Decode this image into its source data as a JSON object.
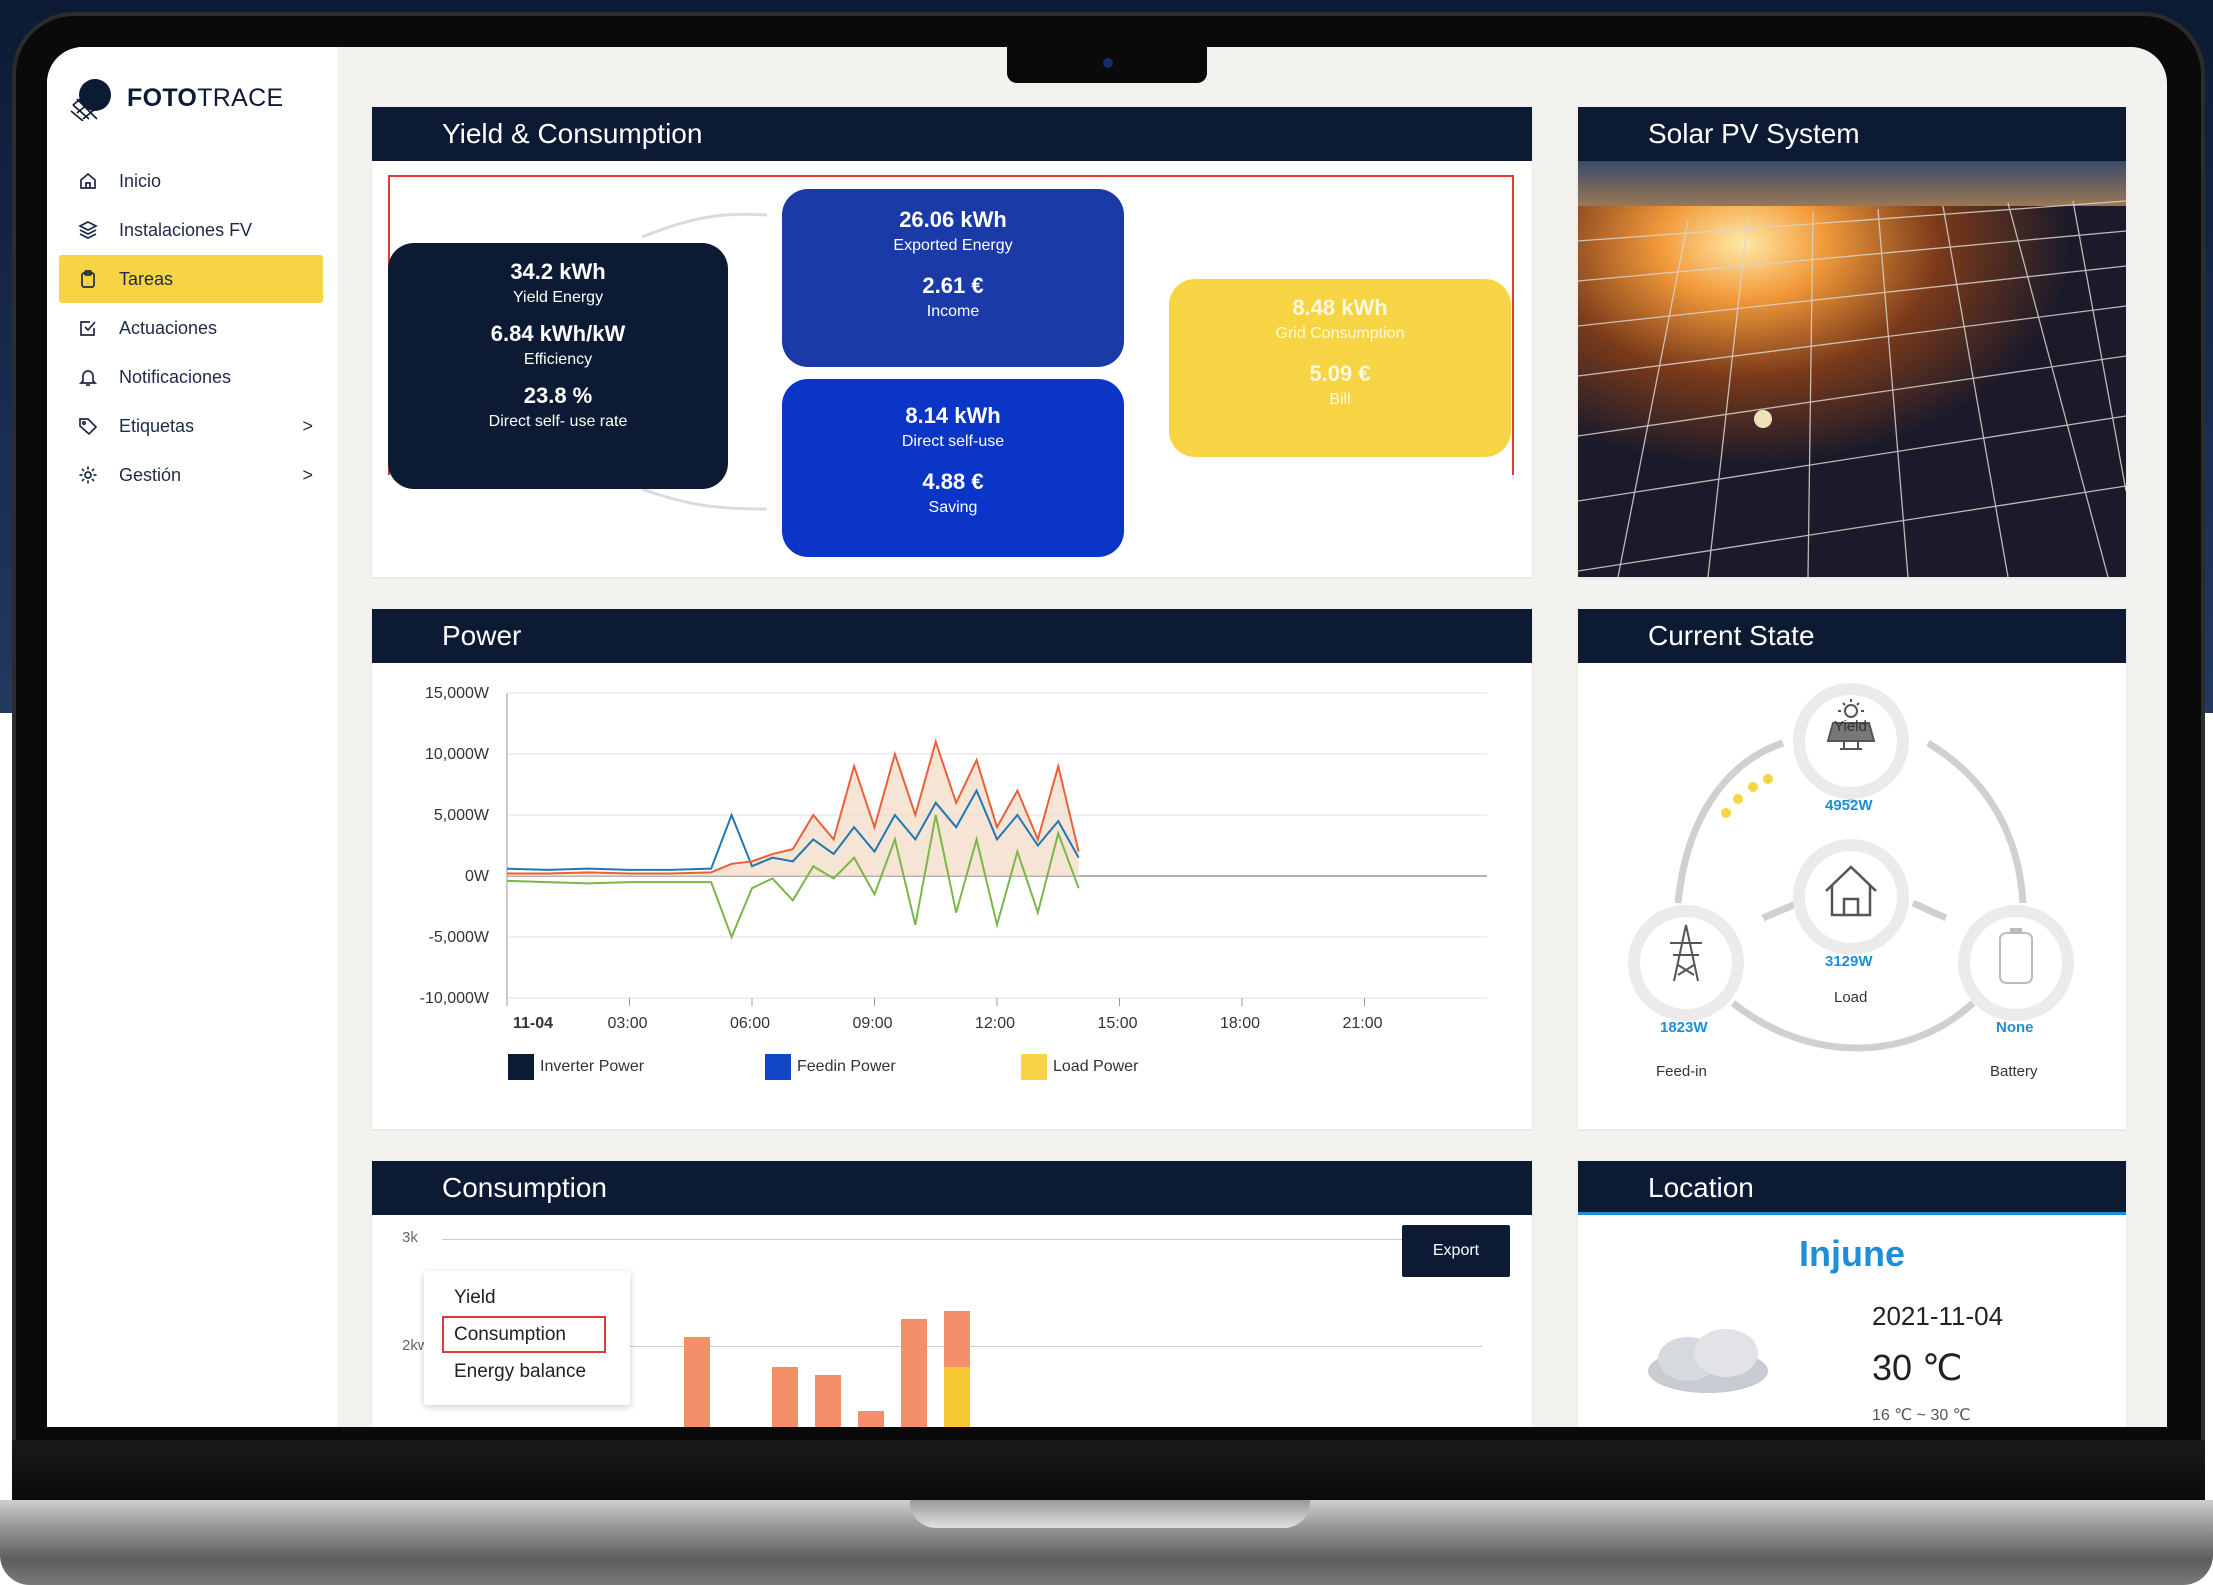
{
  "app": {
    "brand_bold": "FOTO",
    "brand_light": "TRACE"
  },
  "sidebar": {
    "items": [
      {
        "label": "Inicio",
        "icon": "home-icon"
      },
      {
        "label": "Instalaciones FV",
        "icon": "layers-icon"
      },
      {
        "label": "Tareas",
        "icon": "clipboard-icon",
        "active": true
      },
      {
        "label": "Actuaciones",
        "icon": "checkbox-icon"
      },
      {
        "label": "Notificaciones",
        "icon": "bell-icon"
      },
      {
        "label": "Etiquetas",
        "icon": "tag-icon",
        "chevron": ">"
      },
      {
        "label": "Gestión",
        "icon": "gear-icon",
        "chevron": ">"
      }
    ]
  },
  "yield_consumption": {
    "title": "Yield & Consumption",
    "yield_box": {
      "v1": "34.2 kWh",
      "l1": "Yield Energy",
      "v2": "6.84 kWh/kW",
      "l2": "Efficiency",
      "v3": "23.8 %",
      "l3": "Direct self- use rate"
    },
    "export_box": {
      "v1": "26.06 kWh",
      "l1": "Exported Energy",
      "v2": "2.61 €",
      "l2": "Income"
    },
    "selfuse_box": {
      "v1": "8.14 kWh",
      "l1": "Direct self-use",
      "v2": "4.88 €",
      "l2": "Saving"
    },
    "grid_box": {
      "v1": "8.48 kWh",
      "l1": "Grid Consumption",
      "v2": "5.09 €",
      "l2": "Bill"
    }
  },
  "solar_pv": {
    "title": "Solar PV System"
  },
  "power": {
    "title": "Power",
    "legend": [
      {
        "name": "Inverter Power",
        "color": "#0c1a33"
      },
      {
        "name": "Feedin Power",
        "color": "#1147c7"
      },
      {
        "name": "Load Power",
        "color": "#f6d444"
      }
    ]
  },
  "chart_data": {
    "type": "line",
    "title": "",
    "xlabel": "",
    "ylabel": "",
    "x_ticks": [
      "11-04",
      "03:00",
      "06:00",
      "09:00",
      "12:00",
      "15:00",
      "18:00",
      "21:00"
    ],
    "y_ticks": [
      "15,000W",
      "10,000W",
      "5,000W",
      "0W",
      "-5,000W",
      "-10,000W"
    ],
    "ylim": [
      -10000,
      15000
    ],
    "x_hours": [
      0,
      1,
      2,
      3,
      4,
      5,
      5.5,
      6,
      6.5,
      7,
      7.5,
      8,
      8.5,
      9,
      9.5,
      10,
      10.5,
      11,
      11.5,
      12,
      12.5,
      13,
      13.5,
      14
    ],
    "series": [
      {
        "name": "Inverter Power",
        "color": "#1f77b4",
        "values": [
          600,
          500,
          600,
          500,
          500,
          600,
          5000,
          800,
          1500,
          1200,
          3000,
          1800,
          4000,
          2000,
          5000,
          3000,
          6000,
          4000,
          7000,
          3000,
          5000,
          2500,
          4500,
          1500
        ]
      },
      {
        "name": "Feedin Power",
        "color": "#7ab648",
        "values": [
          -400,
          -500,
          -600,
          -500,
          -500,
          -500,
          -5000,
          -1000,
          -200,
          -2000,
          800,
          -200,
          1500,
          -1500,
          3000,
          -4000,
          5000,
          -3000,
          3000,
          -4000,
          2000,
          -3000,
          3500,
          -1000
        ]
      },
      {
        "name": "Load Power",
        "color": "#e8613a",
        "values": [
          200,
          200,
          300,
          200,
          200,
          300,
          1000,
          1200,
          1800,
          2200,
          5000,
          3000,
          9000,
          4000,
          10000,
          5000,
          11000,
          6000,
          9500,
          4000,
          7000,
          3000,
          9000,
          2000
        ]
      }
    ],
    "grid": true,
    "legend_position": "bottom"
  },
  "current_state": {
    "title": "Current State",
    "yield_label": "Yield",
    "yield_value": "4952W",
    "load_label": "Load",
    "load_value": "3129W",
    "feedin_label": "Feed-in",
    "feedin_value": "1823W",
    "battery_label": "Battery",
    "battery_value": "None"
  },
  "consumption": {
    "title": "Consumption",
    "y_ticks": [
      "3k",
      "2kwh"
    ],
    "menu": [
      "Yield",
      "Consumption",
      "Energy balance"
    ],
    "selected": "Consumption",
    "export_label": "Export"
  },
  "location": {
    "title": "Location",
    "city": "Injune",
    "date": "2021-11-04",
    "temp": "30 ℃",
    "range": "16 ℃ ~ 30 ℃"
  }
}
